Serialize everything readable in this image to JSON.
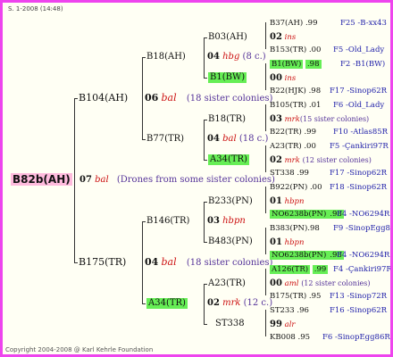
{
  "header": "S. 1-2008 (14:48)",
  "footer": "Copyright 2004-2008 @ Karl Kehrle Foundation",
  "root": "B82b(AH)",
  "root_num": "07",
  "root_breed": "bal",
  "root_note": "(Drones from some sister colonies)",
  "b104": "B104(AH)",
  "b104_num": "06",
  "b104_breed": "bal",
  "b104_note": "(18 sister colonies)",
  "b18": "B18(AH)",
  "b03": "B03(AH)",
  "b03_num": "04",
  "b03_breed": "hbg",
  "b03_note": "(8 c.)",
  "b1": "B1(BW)",
  "b1_num": "00",
  "b1_breed": "ins",
  "b77": "B77(TR)",
  "b18tr": "B18(TR)",
  "b18tr_num": "03",
  "b18tr_breed": "mrk",
  "b18tr_note": "(15 sister colonies)",
  "b77_num": "04",
  "b77_breed": "bal",
  "b77_note": "(18 c.)",
  "a34": "A34(TR)",
  "a34_num": "02",
  "a34_breed": "mrk",
  "a34_note": "(12 sister colonies)",
  "b175": "B175(TR)",
  "b175_num": "04",
  "b175_breed": "bal",
  "b175_note": "(18 sister colonies)",
  "b146": "B146(TR)",
  "b233": "B233(PN)",
  "b233_num": "01",
  "b233_breed": "hbpn",
  "b146_num": "03",
  "b146_breed": "hbpn",
  "b483": "B483(PN)",
  "b483_num": "01",
  "b483_breed": "hbpn",
  "a34b": "A34(TR)",
  "a23": "A23(TR)",
  "a23_num": "00",
  "a23_breed": "aml",
  "a23_note": "(12 sister colonies)",
  "a34b_num": "02",
  "a34b_breed": "mrk",
  "a34b_note": "(12 c.)",
  "st338": "ST338",
  "st338_num": "99",
  "st338_breed": "alr",
  "r": [
    {
      "name": "B37(AH)",
      "val": ".99",
      "ref": "F25 -B-xx43"
    },
    {
      "name": "B153(TR)",
      "val": ".00",
      "ref": "F5 -Old_Lady"
    },
    {
      "name": "B1(BW)",
      "val": ".98",
      "ref": "F2 -B1(BW)"
    },
    {
      "name": "B22(HJK)",
      "val": ".98",
      "ref": "F17 -Sinop62R"
    },
    {
      "name": "B105(TR)",
      "val": ".01",
      "ref": "F6 -Old_Lady"
    },
    {
      "name": "B22(TR)",
      "val": ".99",
      "ref": "F10 -Atlas85R"
    },
    {
      "name": "A23(TR)",
      "val": ".00",
      "ref": "F5 -Çankiri97R"
    },
    {
      "name": "ST338",
      "val": ".99",
      "ref": "F17 -Sinop62R"
    },
    {
      "name": "B922(PN)",
      "val": ".00",
      "ref": "F18 -Sinop62R"
    },
    {
      "name": "NO6238b(PN)",
      "val": ".98",
      "ref": "F4 -NO6294R"
    },
    {
      "name": "B383(PN)",
      "val": ".98",
      "ref": "F9 -SinopEgg86R"
    },
    {
      "name": "NO6238b(PN)",
      "val": ".98",
      "ref": "F4 -NO6294R"
    },
    {
      "name": "A126(TR)",
      "val": ".99",
      "ref": "F4 -Çankiri97R"
    },
    {
      "name": "B175(TR)",
      "val": ".95",
      "ref": "F13 -Sinop72R"
    },
    {
      "name": "ST233",
      "val": ".96",
      "ref": "F16 -Sinop62R"
    },
    {
      "name": "KB008",
      "val": ".95",
      "ref": "F6 -SinopEgg86R"
    }
  ],
  "rn": [
    {
      "num": "02",
      "breed": "ins"
    },
    {
      "num": "00",
      "breed": "ins"
    },
    {
      "num": "03",
      "breed": "mrk",
      "note": "(15 sister colonies)"
    },
    {
      "num": "02",
      "breed": "mrk",
      "note": "(12 sister colonies)"
    },
    {
      "num": "01",
      "breed": "hbpn"
    },
    {
      "num": "01",
      "breed": "hbpn"
    },
    {
      "num": "00",
      "breed": "aml",
      "note": "(12 sister colonies)"
    },
    {
      "num": "99",
      "breed": "alr"
    }
  ]
}
